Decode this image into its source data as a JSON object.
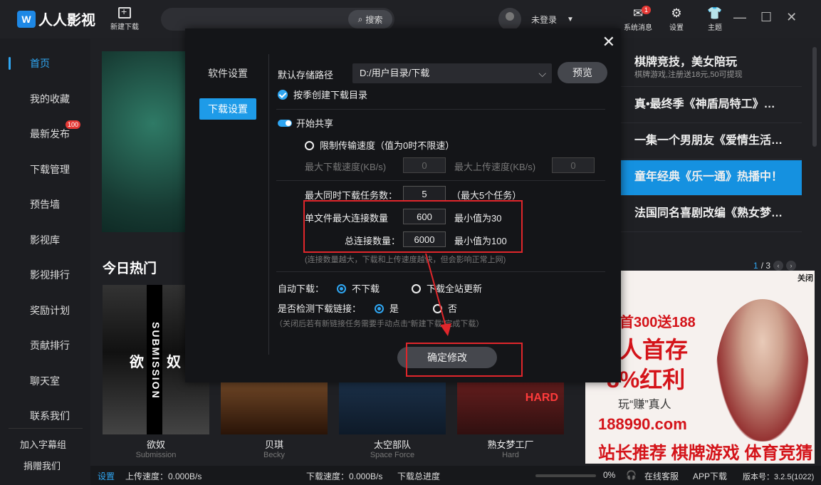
{
  "app": {
    "logo_text": "人人影视",
    "logo_mark": "W"
  },
  "toolbar": {
    "new_download": "新建下载",
    "search_placeholder": "",
    "search_button": "搜索",
    "user_label": "未登录",
    "icons": [
      {
        "name": "system-message-icon",
        "label": "系统消息",
        "badge": "1",
        "glyph": "✉"
      },
      {
        "name": "settings-icon",
        "label": "设置",
        "glyph": "⚙"
      },
      {
        "name": "theme-icon",
        "label": "主题",
        "glyph": "👕"
      }
    ],
    "window_controls": [
      "—",
      "☐",
      "✕"
    ]
  },
  "sidebar": {
    "items": [
      {
        "label": "首页",
        "active": true
      },
      {
        "label": "我的收藏"
      },
      {
        "label": "最新发布",
        "badge": "100"
      },
      {
        "label": "下载管理"
      },
      {
        "label": "预告墙"
      },
      {
        "label": "影视库"
      },
      {
        "label": "影视排行"
      },
      {
        "label": "奖励计划"
      },
      {
        "label": "贡献排行"
      },
      {
        "label": "聊天室"
      },
      {
        "label": "联系我们"
      }
    ],
    "bottom": [
      "加入字幕组",
      "捐赠我们"
    ]
  },
  "right_list": [
    {
      "title": "棋牌竞技，美女陪玩",
      "sub": "棋牌游戏,注册送18元,50可提现"
    },
    {
      "title": "真•最终季《神盾局特工》…"
    },
    {
      "title": "一集一个男朋友《爱情生活…"
    },
    {
      "title": "童年经典《乐一通》热播中！",
      "active": true
    },
    {
      "title": "法国同名喜剧改编《熟女梦…"
    }
  ],
  "hot": {
    "title": "今日热门",
    "pager_current": "1",
    "pager_total": "/ 3",
    "cards": [
      {
        "name": "欲奴",
        "sub": "Submission",
        "poster_text": "SUBMISSION",
        "poster_cn_left": "欲",
        "poster_cn_right": "奴"
      },
      {
        "name": "贝琪",
        "sub": "Becky"
      },
      {
        "name": "太空部队",
        "sub": "Space Force"
      },
      {
        "name": "熟女梦工厂",
        "sub": "Hard",
        "poster_text": "HARD"
      }
    ]
  },
  "ad": {
    "close": "关闭",
    "line1": "首300送188",
    "line2": "人首存",
    "line3": "8%红利",
    "line4": "玩“赚”真人",
    "line5": "188990.com",
    "line6": "站长推荐 棋牌游戏 体育竞猜"
  },
  "statusbar": {
    "settings": "设置",
    "upload_speed": "上传速度：0.000B/s",
    "download_speed": "下载速度：0.000B/s",
    "total_progress_label": "下载总进度",
    "progress_value": 0,
    "progress_text": "0%",
    "support": "在线客服",
    "app_download": "APP下载",
    "version": "版本号：3.2.5(1022)"
  },
  "dialog": {
    "close": "✕",
    "nav": [
      {
        "label": "软件设置"
      },
      {
        "label": "下载设置",
        "active": true
      }
    ],
    "storage_label": "默认存储路径",
    "storage_path": "D:/用户目录/下载",
    "preview_button": "预览",
    "season_dir_label": "按季创建下载目录",
    "start_share_label": "开始共享",
    "limit_speed_label": "限制传输速度（值为0时不限速）",
    "max_down_label": "最大下载速度(KB/s)",
    "max_down_value": "0",
    "max_up_label": "最大上传速度(KB/s)",
    "max_up_value": "0",
    "max_tasks_label": "最大同时下载任务数：",
    "max_tasks_value": "5",
    "max_tasks_hint": "（最大5个任务）",
    "per_file_label": "单文件最大连接数量",
    "per_file_value": "600",
    "per_file_hint": "最小值为30",
    "total_conn_label": "总连接数量：",
    "total_conn_value": "6000",
    "total_conn_hint": "最小值为100",
    "conn_note": "(连接数量越大，下载和上传速度越快，但会影响正常上网)",
    "auto_dl_label": "自动下载：",
    "auto_dl_opt1": "不下载",
    "auto_dl_opt2": "下载全站更新",
    "detect_label": "是否检测下载链接：",
    "detect_yes": "是",
    "detect_no": "否",
    "detect_note": "（关闭后若有新链接任务需要手动点击“新建下载”完成下载）",
    "confirm_button": "确定修改"
  }
}
